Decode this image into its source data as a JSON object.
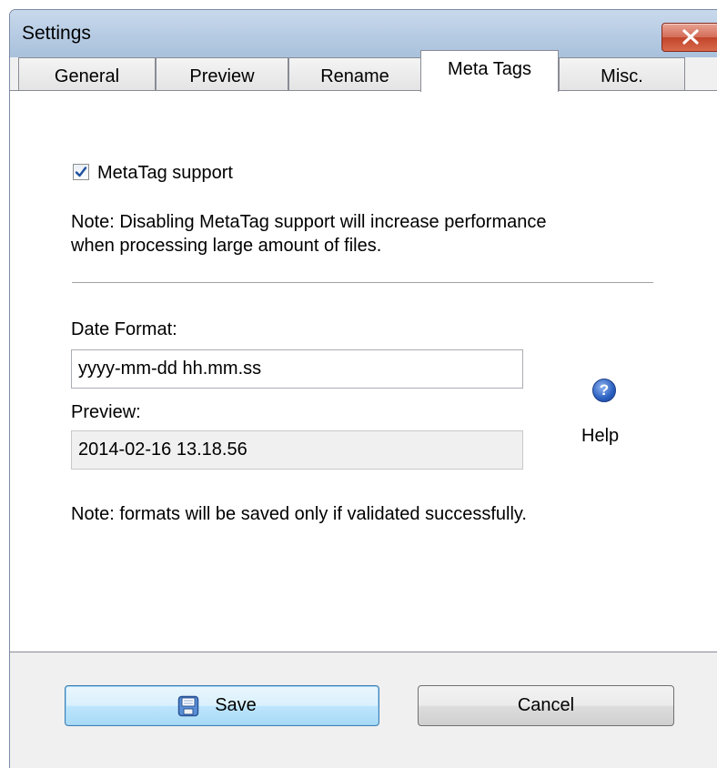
{
  "window": {
    "title": "Settings"
  },
  "tabs": [
    {
      "label": "General",
      "active": false
    },
    {
      "label": "Preview",
      "active": false
    },
    {
      "label": "Rename",
      "active": false
    },
    {
      "label": "Meta Tags",
      "active": true
    },
    {
      "label": "Misc.",
      "active": false
    }
  ],
  "metatags": {
    "support_label": "MetaTag support",
    "support_checked": true,
    "note_line1": "Note: Disabling MetaTag support will increase performance",
    "note_line2": "when processing large amount of files.",
    "date_format_label": "Date Format:",
    "date_format_value": "yyyy-mm-dd hh.mm.ss",
    "preview_label": "Preview:",
    "preview_value": "2014-02-16 13.18.56",
    "help_label": "Help",
    "help_icon": "help-question-icon",
    "validation_note": "Note: formats will be saved only if validated successfully."
  },
  "buttons": {
    "save_label": "Save",
    "save_icon": "floppy-disk-icon",
    "cancel_label": "Cancel"
  },
  "colors": {
    "close_button": "#c7503a",
    "title_bar": "#b9cde4",
    "default_button_border": "#3c7fb1",
    "help_icon": "#2a5fc0"
  }
}
